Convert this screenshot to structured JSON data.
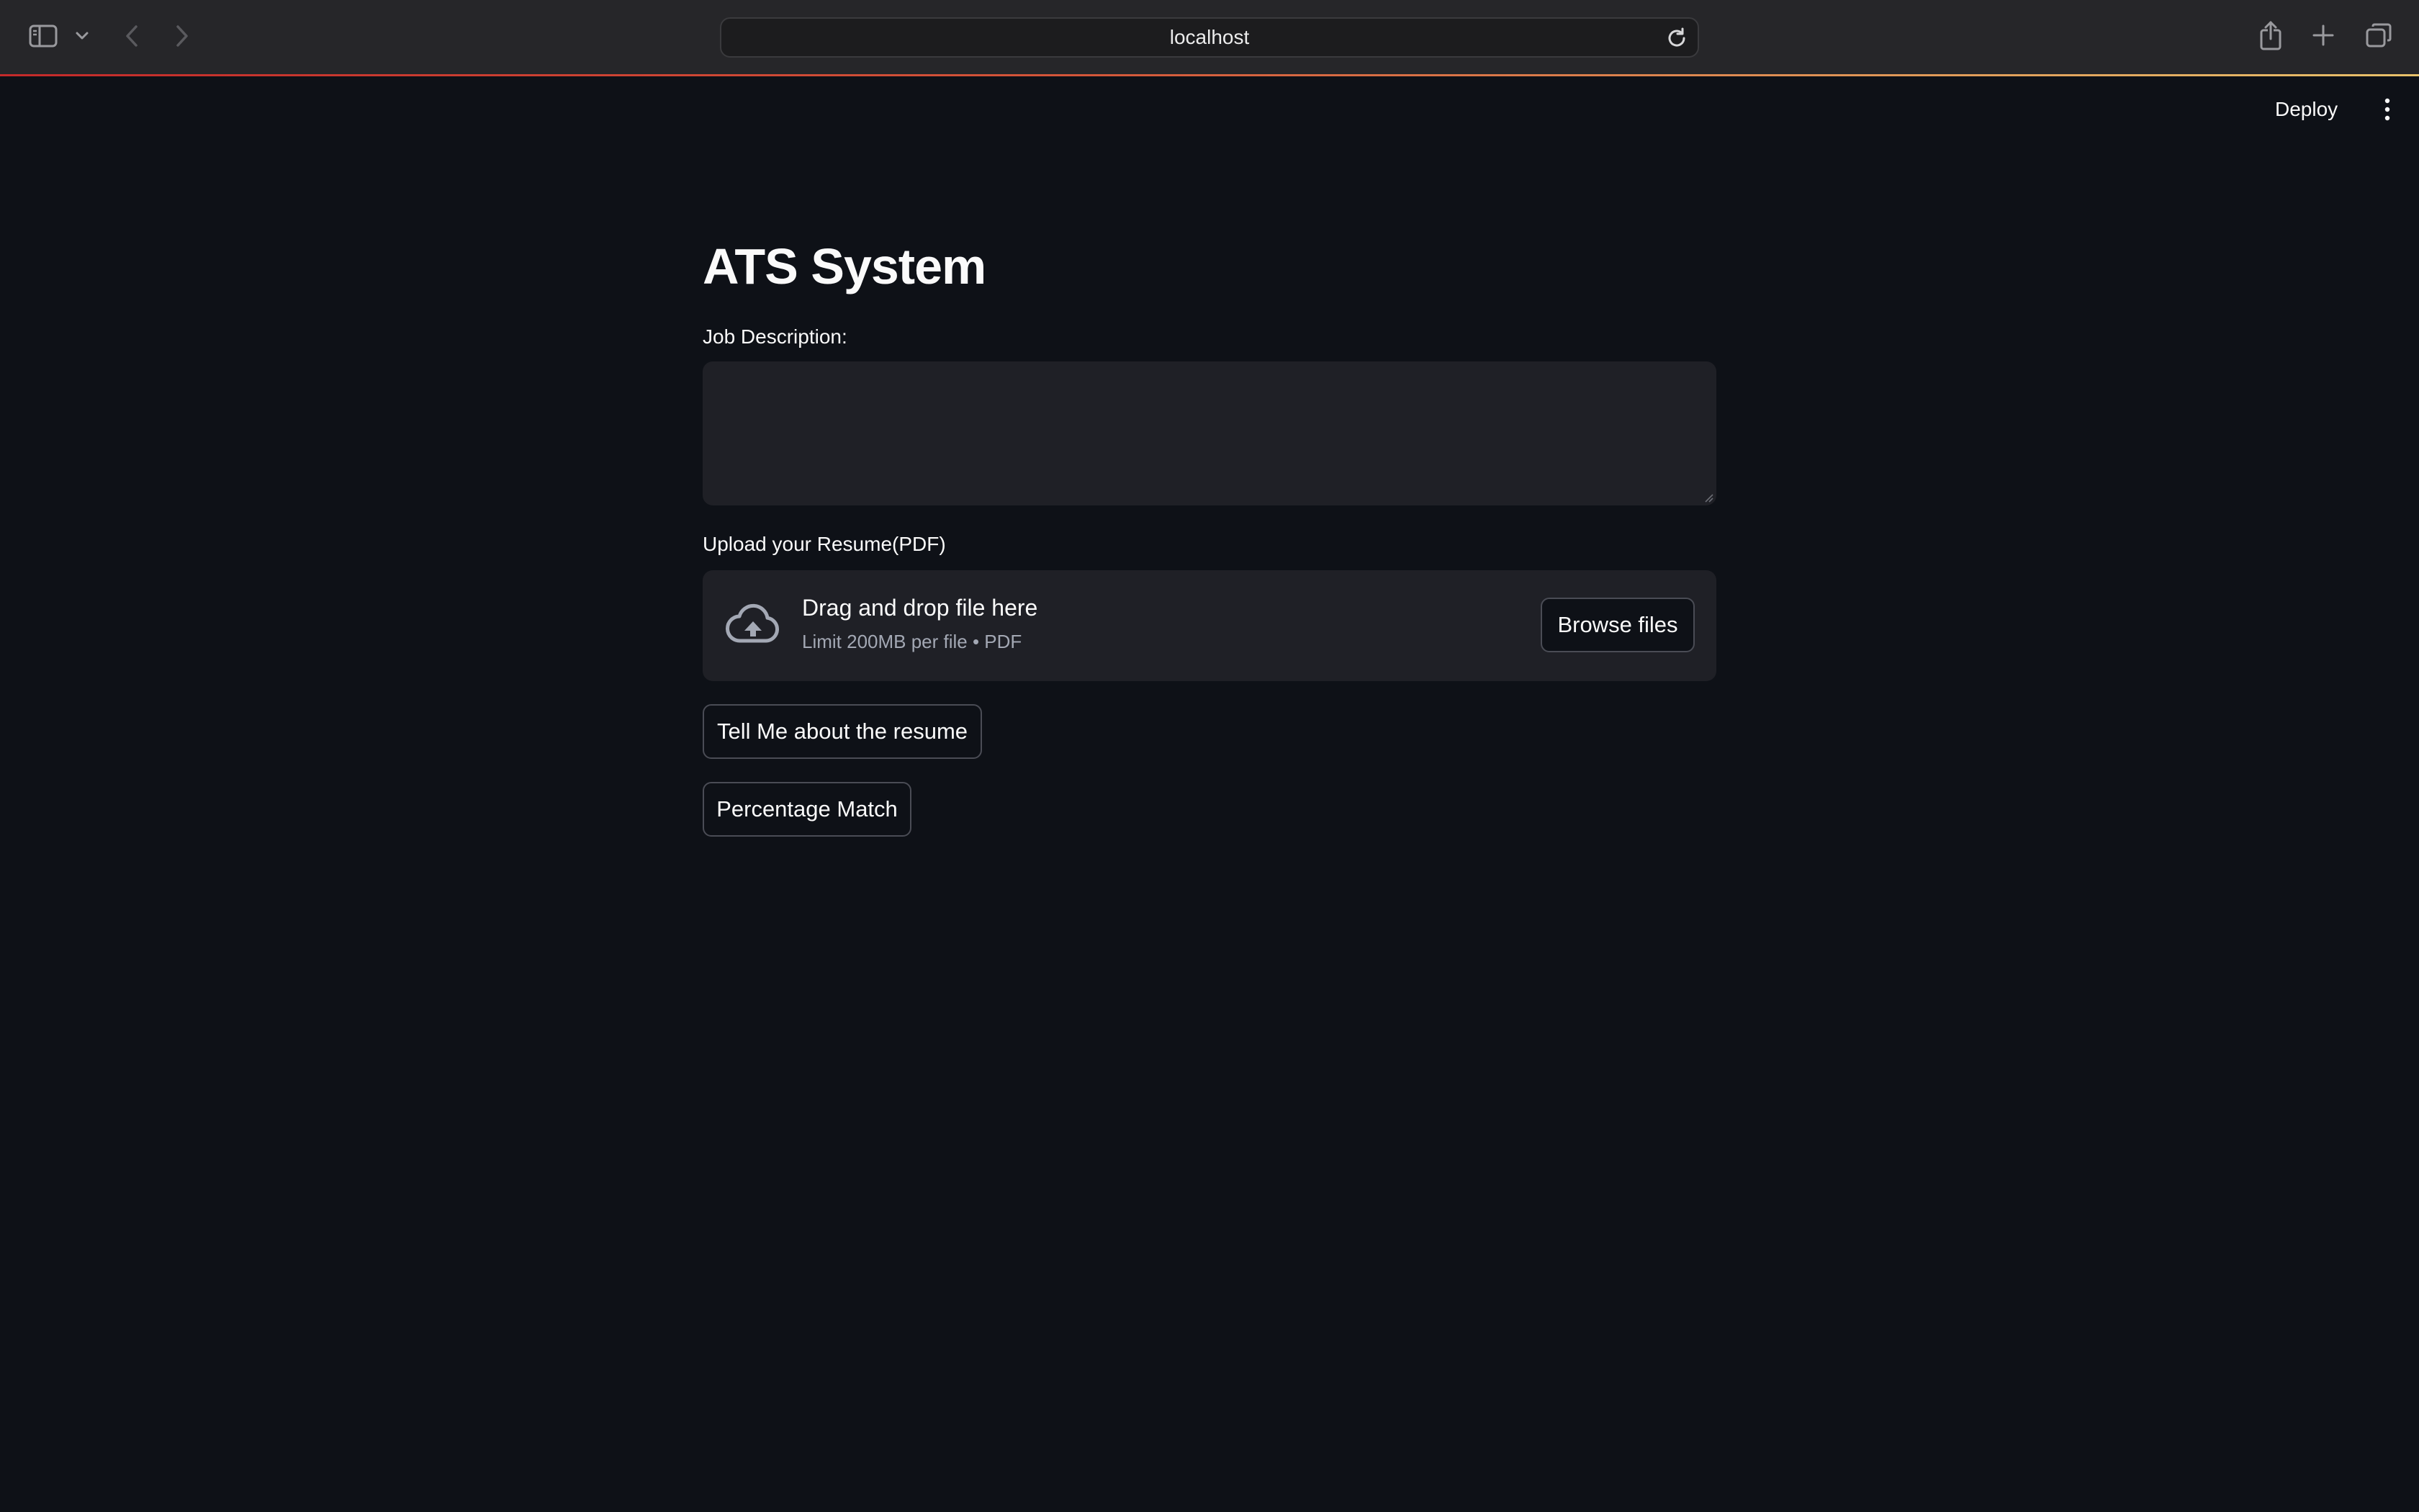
{
  "browser": {
    "url": "localhost",
    "icons": [
      "sidebar-icon",
      "chevron-down-icon",
      "back-icon",
      "forward-icon",
      "reload-icon",
      "share-icon",
      "plus-icon",
      "tabs-icon"
    ]
  },
  "app_header": {
    "deploy_label": "Deploy",
    "menu_icon": "kebab-icon"
  },
  "main": {
    "title": "ATS System",
    "job_description": {
      "label": "Job Description:",
      "value": ""
    },
    "uploader": {
      "label": "Upload your Resume(PDF)",
      "drop_text": "Drag and drop file here",
      "limit_text": "Limit 200MB per file • PDF",
      "browse_label": "Browse files",
      "icon": "cloud-upload-icon"
    },
    "buttons": {
      "tell_me": "Tell Me about the resume",
      "percentage_match": "Percentage Match"
    }
  },
  "colors": {
    "background": "#0e1117",
    "toolbar": "#262629",
    "input_bg": "#1f2026",
    "text": "#fafafa",
    "muted_text": "#a3a8b4",
    "accent_red": "#c42a2a"
  }
}
